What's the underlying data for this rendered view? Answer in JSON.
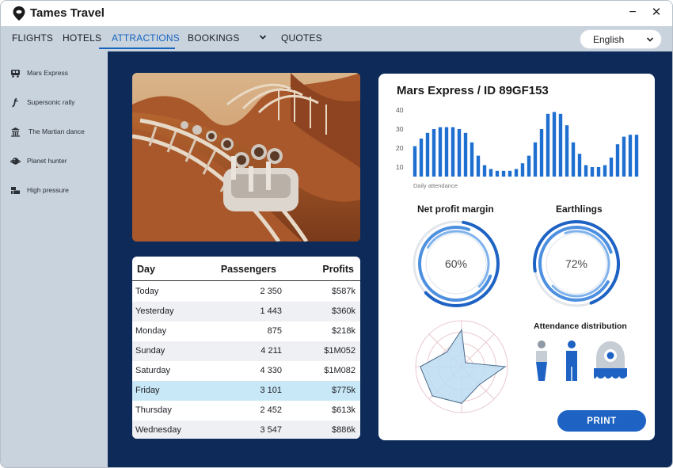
{
  "app": {
    "title": "Tames Travel"
  },
  "window_controls": {
    "minimize": "−",
    "close": "✕"
  },
  "nav": {
    "tabs": [
      {
        "label": "FLIGHTS",
        "active": false
      },
      {
        "label": "HOTELS",
        "active": false
      },
      {
        "label": "ATTRACTIONS",
        "active": true
      },
      {
        "label": "BOOKINGS",
        "active": false
      },
      {
        "label": "QUOTES",
        "active": false
      }
    ],
    "language": "English"
  },
  "sidebar": {
    "items": [
      {
        "label": "Mars Express",
        "icon": "train-icon"
      },
      {
        "label": "Supersonic rally",
        "icon": "rally-icon"
      },
      {
        "label": "The Martian dance",
        "icon": "dance-icon"
      },
      {
        "label": "Planet hunter",
        "icon": "planet-icon"
      },
      {
        "label": "High pressure",
        "icon": "pressure-icon"
      }
    ]
  },
  "table": {
    "headers": [
      "Day",
      "Passengers",
      "Profits"
    ],
    "rows": [
      {
        "day": "Today",
        "passengers": "2 350",
        "profits": "$587k"
      },
      {
        "day": "Yesterday",
        "passengers": "1 443",
        "profits": "$360k"
      },
      {
        "day": "Monday",
        "passengers": "875",
        "profits": "$218k"
      },
      {
        "day": "Sunday",
        "passengers": "4 211",
        "profits": "$1M052"
      },
      {
        "day": "Saturday",
        "passengers": "4 330",
        "profits": "$1M082"
      },
      {
        "day": "Friday",
        "passengers": "3 101",
        "profits": "$775k",
        "selected": true
      },
      {
        "day": "Thursday",
        "passengers": "2 452",
        "profits": "$613k"
      },
      {
        "day": "Wednesday",
        "passengers": "3 547",
        "profits": "$886k"
      }
    ]
  },
  "panel": {
    "title": "Mars Express / ID 89GF153",
    "print_label": "PRINT",
    "distribution_title": "Attendance distribution"
  },
  "chart_data": [
    {
      "type": "bar",
      "xlabel": "Daily attendance",
      "ylim": [
        5,
        40
      ],
      "yticks": [
        10,
        20,
        30,
        40
      ],
      "values": [
        21,
        25,
        28,
        30,
        31,
        31,
        31,
        30,
        28,
        23,
        16,
        11,
        9,
        8,
        8,
        8,
        9,
        12,
        16,
        23,
        30,
        38,
        39,
        38,
        32,
        23,
        17,
        11,
        10,
        10,
        11,
        15,
        22,
        26,
        27,
        27
      ]
    },
    {
      "type": "pie",
      "title": "Net profit margin",
      "value": 60,
      "label": "60%"
    },
    {
      "type": "pie",
      "title": "Earthlings",
      "value": 72,
      "label": "72%"
    },
    {
      "type": "radar",
      "series": [
        {
          "values": [
            0.8,
            0.12,
            0.95,
            0.55,
            0.8,
            0.9,
            0.9,
            0.45
          ]
        }
      ]
    }
  ],
  "colors": {
    "accent": "#1565c0",
    "main_bg": "#0d2a58",
    "bar": "#1f6fd1",
    "radar_fill": "#bcdcf2"
  }
}
